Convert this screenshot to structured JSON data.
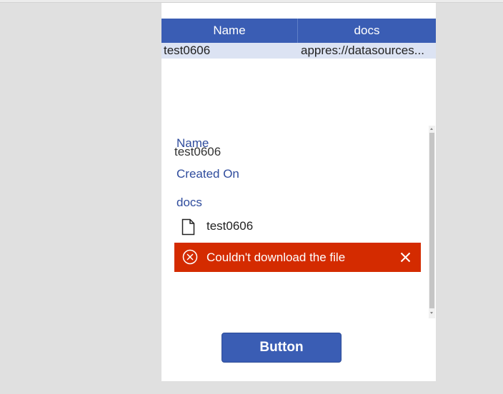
{
  "table": {
    "columns": [
      "Name",
      "docs"
    ],
    "rows": [
      [
        "test0606",
        "appres://datasources..."
      ]
    ]
  },
  "form": {
    "name_label": "Name",
    "name_value": "test0606",
    "created_on_label": "Created On",
    "docs_label": "docs",
    "attachment_name": "test0606",
    "error_message": "Couldn't download the file"
  },
  "button": {
    "label": "Button"
  },
  "colors": {
    "header": "#3a5db4",
    "selected_row": "#dce3f3",
    "field_label": "#2f4c9d",
    "error": "#d42b00"
  },
  "icons": [
    "file-icon",
    "error-circle-icon",
    "close-icon"
  ]
}
